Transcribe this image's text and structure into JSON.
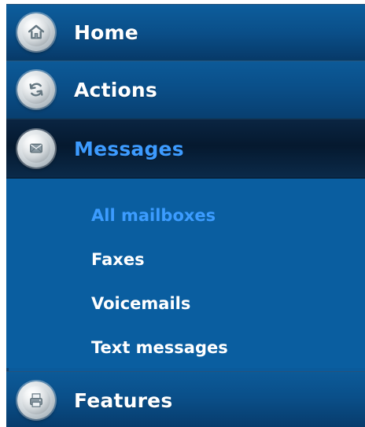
{
  "menu": {
    "items": [
      {
        "id": "home",
        "label": "Home",
        "icon": "home-icon"
      },
      {
        "id": "actions",
        "label": "Actions",
        "icon": "refresh-icon"
      },
      {
        "id": "messages",
        "label": "Messages",
        "icon": "envelope-icon",
        "active": true
      }
    ],
    "messages_submenu": [
      {
        "id": "all-mailboxes",
        "label": "All mailboxes",
        "selected": true
      },
      {
        "id": "faxes",
        "label": "Faxes"
      },
      {
        "id": "voicemails",
        "label": "Voicemails"
      },
      {
        "id": "text-messages",
        "label": "Text messages"
      }
    ],
    "features": {
      "label": "Features",
      "icon": "printer-icon"
    }
  },
  "colors": {
    "menu_background": "#0a5b9c",
    "active_background": "#05192f",
    "active_text": "#3d9bff",
    "default_text": "#ffffff"
  }
}
